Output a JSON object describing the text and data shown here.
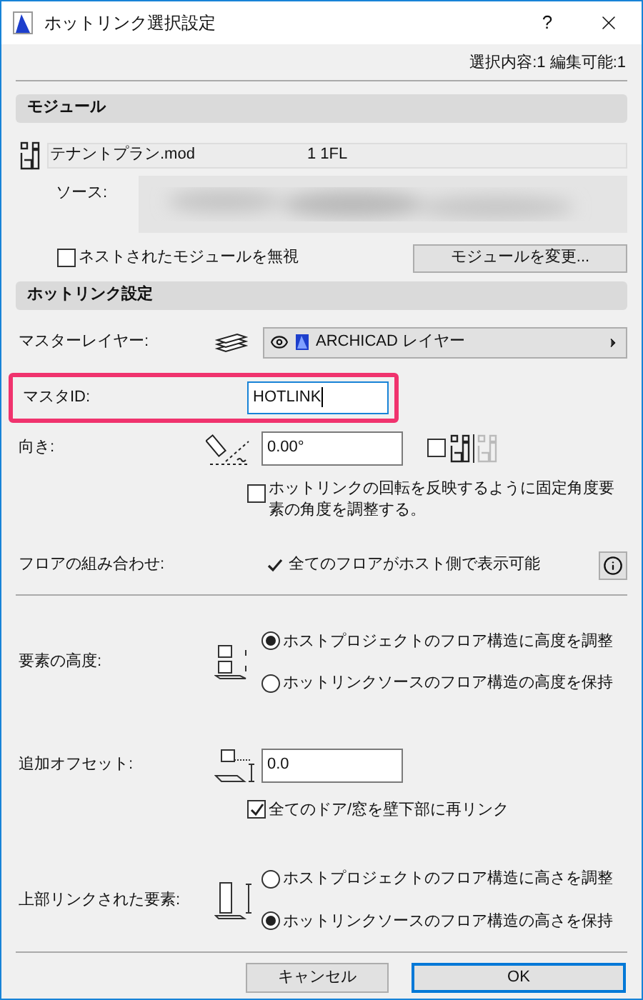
{
  "window": {
    "title": "ホットリンク選択設定",
    "help": "?"
  },
  "selection_info": "選択内容:1 編集可能:1",
  "module_section": {
    "header": "モジュール",
    "module_name": "テナントプラン.mod",
    "module_floor": "1 1FL",
    "source_label": "ソース:",
    "ignore_nested": {
      "label": "ネストされたモジュールを無視",
      "checked": false
    },
    "change_button": "モジュールを変更..."
  },
  "hotlink_section": {
    "header": "ホットリンク設定",
    "master_layer": {
      "label": "マスターレイヤー:",
      "value": "ARCHICAD レイヤー",
      "visible": true
    },
    "master_id": {
      "label": "マスタID:",
      "value": "HOTLINK",
      "highlighted": true
    },
    "orientation": {
      "label": "向き:",
      "value": "0.00°",
      "mirror_checked": false
    },
    "adjust_angle": {
      "label": "ホットリンクの回転を反映するように固定角度要素の角度を調整する。",
      "checked": false
    },
    "floor_combination": {
      "label": "フロアの組み合わせ:",
      "value": "全てのフロアがホスト側で表示可能"
    }
  },
  "element_height": {
    "label": "要素の高度:",
    "options": [
      {
        "label": "ホストプロジェクトのフロア構造に高度を調整",
        "selected": true
      },
      {
        "label": "ホットリンクソースのフロア構造の高度を保持",
        "selected": false
      }
    ]
  },
  "offset": {
    "label": "追加オフセット:",
    "value": "0.0",
    "relink": {
      "label": "全てのドア/窓を壁下部に再リンク",
      "checked": true
    }
  },
  "top_linked": {
    "label": "上部リンクされた要素:",
    "options": [
      {
        "label": "ホストプロジェクトのフロア構造に高さを調整",
        "selected": false
      },
      {
        "label": "ホットリンクソースのフロア構造の高さを保持",
        "selected": true
      }
    ]
  },
  "buttons": [
    {
      "label": "キャンセル",
      "default": false
    },
    {
      "label": "OK",
      "default": true
    }
  ]
}
